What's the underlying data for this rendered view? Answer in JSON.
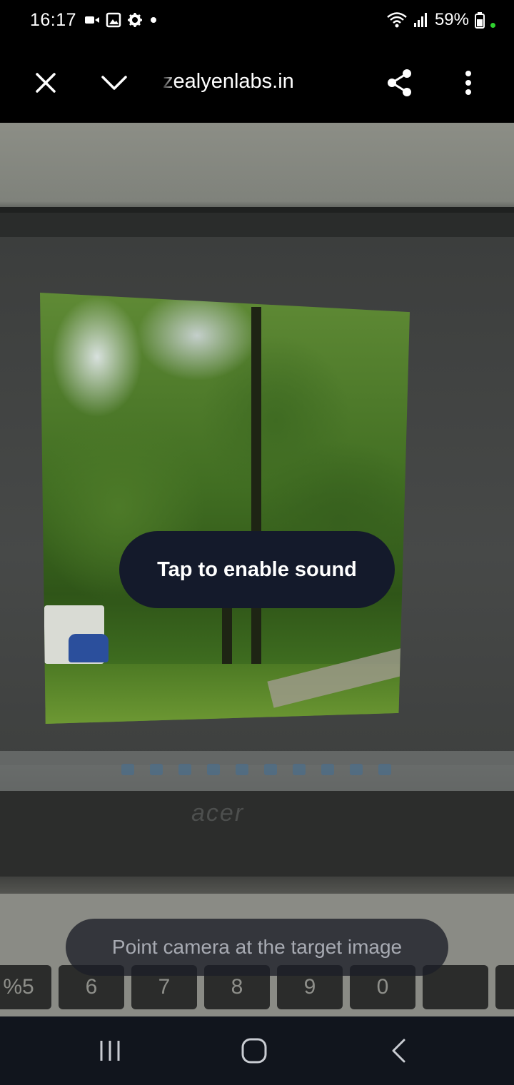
{
  "status_bar": {
    "time": "16:17",
    "battery_percent": "59%",
    "left_icons": [
      "video-camera-icon",
      "image-icon",
      "settings-gear-icon",
      "notification-dot-icon"
    ],
    "right_icons": [
      "wifi-icon",
      "cellular-signal-icon",
      "battery-icon"
    ]
  },
  "toolbar": {
    "url": "zealyenlabs.in",
    "close_icon": "close-icon",
    "collapse_icon": "chevron-down-icon",
    "share_icon": "share-icon",
    "menu_icon": "more-vertical-icon"
  },
  "ar_view": {
    "sound_button_label": "Tap to enable sound",
    "hint_text": "Point camera at the target image",
    "laptop_brand": "acer",
    "keyboard_keys": [
      "%5",
      "6",
      "7",
      "8",
      "9",
      "0"
    ]
  },
  "navbar": {
    "recents_icon": "recent-apps-icon",
    "home_icon": "home-icon",
    "back_icon": "back-icon"
  },
  "colors": {
    "pill_background": "#141a2b",
    "status_green": "#2fd12f",
    "navbar_background": "#11151d"
  }
}
